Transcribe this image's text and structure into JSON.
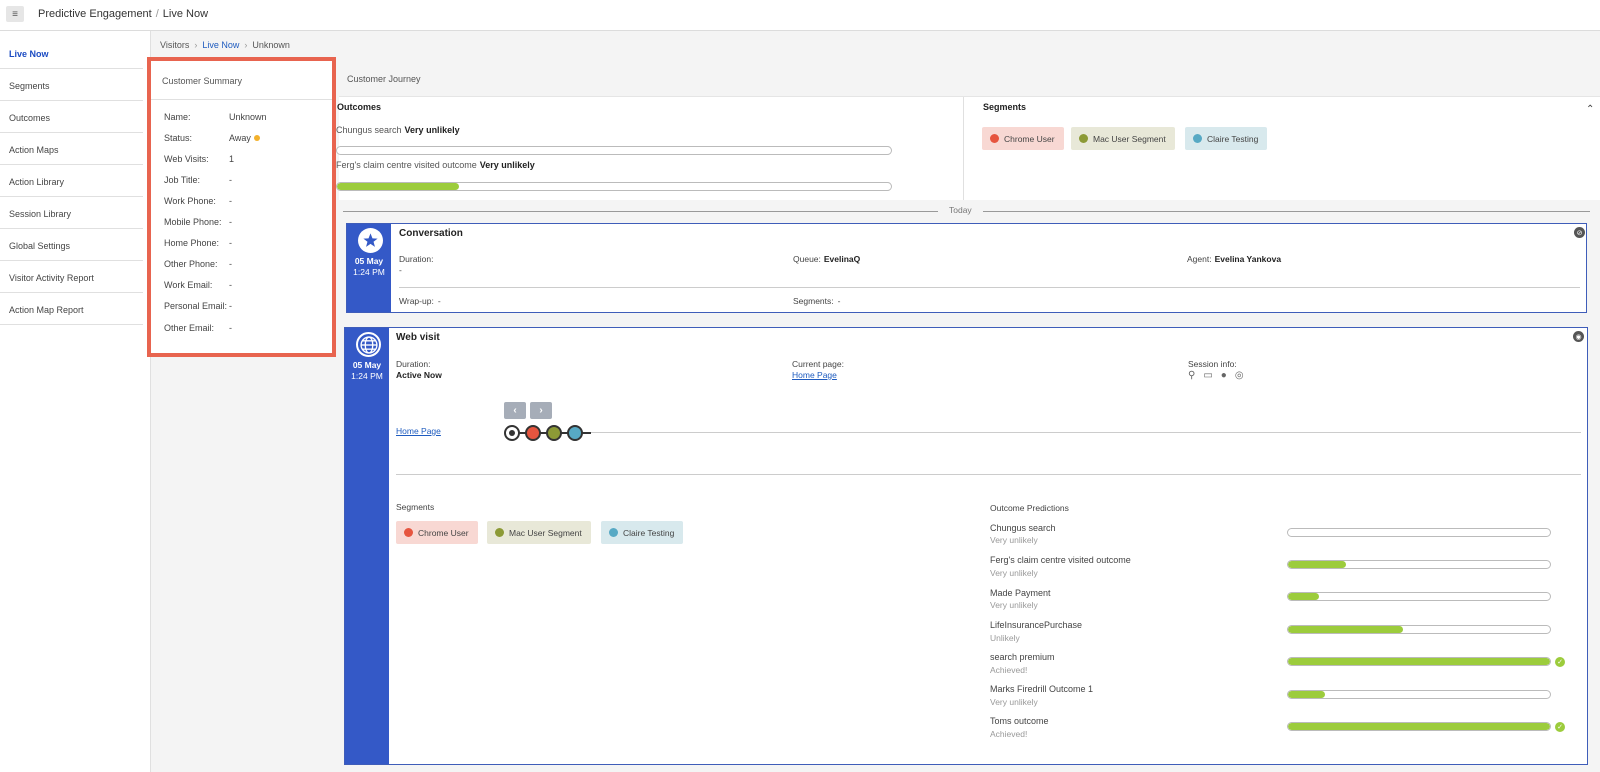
{
  "header": {
    "app_name": "Predictive Engagement",
    "separator": "/",
    "page": "Live Now"
  },
  "sidebar": {
    "items": [
      {
        "label": "Live Now",
        "active": true
      },
      {
        "label": "Segments"
      },
      {
        "label": "Outcomes"
      },
      {
        "label": "Action Maps"
      },
      {
        "label": "Action Library"
      },
      {
        "label": "Session Library"
      },
      {
        "label": "Global Settings"
      },
      {
        "label": "Visitor Activity Report"
      },
      {
        "label": "Action Map Report"
      }
    ]
  },
  "breadcrumb": {
    "root": "Visitors",
    "middle": "Live Now",
    "current": "Unknown"
  },
  "summary": {
    "title": "Customer Summary",
    "fields": [
      {
        "label": "Name:",
        "value": "Unknown"
      },
      {
        "label": "Status:",
        "value": "Away"
      },
      {
        "label": "Web Visits:",
        "value": "1"
      },
      {
        "label": "Job Title:",
        "value": "-"
      },
      {
        "label": "Work Phone:",
        "value": "-"
      },
      {
        "label": "Mobile Phone:",
        "value": "-"
      },
      {
        "label": "Home Phone:",
        "value": "-"
      },
      {
        "label": "Other Phone:",
        "value": "-"
      },
      {
        "label": "Work Email:",
        "value": "-"
      },
      {
        "label": "Personal Email:",
        "value": "-"
      },
      {
        "label": "Other Email:",
        "value": "-"
      }
    ]
  },
  "journey": {
    "title": "Customer Journey",
    "outcomes_title": "Outcomes",
    "outcomes": [
      {
        "name": "Chungus search",
        "status": "Very unlikely",
        "progress": 0.0
      },
      {
        "name": "Ferg's claim centre visited outcome",
        "status": "Very unlikely",
        "progress": 0.22
      }
    ],
    "segments_title": "Segments",
    "segments": [
      "Chrome User",
      "Mac User Segment",
      "Claire Testing"
    ],
    "today_label": "Today"
  },
  "conversation": {
    "title": "Conversation",
    "date": "05 May",
    "time": "1:24 PM",
    "duration_label": "Duration:",
    "duration_value": "-",
    "queue_label": "Queue:",
    "queue_value": "EvelinaQ",
    "agent_label": "Agent:",
    "agent_value": "Evelina Yankova",
    "wrapup_label": "Wrap-up:",
    "wrapup_value": "-",
    "segments_label": "Segments:",
    "segments_value": "-"
  },
  "web_visit": {
    "title": "Web visit",
    "date": "05 May",
    "time": "1:24 PM",
    "duration_label": "Duration:",
    "duration_value": "Active Now",
    "current_page_label": "Current page:",
    "current_page_value": "Home Page",
    "session_info_label": "Session info:",
    "page_link": "Home Page",
    "segments_label": "Segments",
    "segments": [
      "Chrome User",
      "Mac User Segment",
      "Claire Testing"
    ],
    "predictions_title": "Outcome Predictions",
    "predictions": [
      {
        "name": "Chungus search",
        "status": "Very unlikely",
        "progress": 0.0,
        "achieved": false
      },
      {
        "name": "Ferg's claim centre visited outcome",
        "status": "Very unlikely",
        "progress": 0.22,
        "achieved": false
      },
      {
        "name": "Made Payment",
        "status": "Very unlikely",
        "progress": 0.12,
        "achieved": false
      },
      {
        "name": "LifeInsurancePurchase",
        "status": "Unlikely",
        "progress": 0.44,
        "achieved": false
      },
      {
        "name": "search premium",
        "status": "Achieved!",
        "progress": 1.0,
        "achieved": true
      },
      {
        "name": "Marks Firedrill Outcome 1",
        "status": "Very unlikely",
        "progress": 0.14,
        "achieved": false
      },
      {
        "name": "Toms outcome",
        "status": "Achieved!",
        "progress": 1.0,
        "achieved": true
      }
    ]
  },
  "colors": {
    "accent": "#3459c7",
    "highlight_border": "#e8644f",
    "progress_fill": "#9ccc3c",
    "link": "#1e5bbf"
  }
}
